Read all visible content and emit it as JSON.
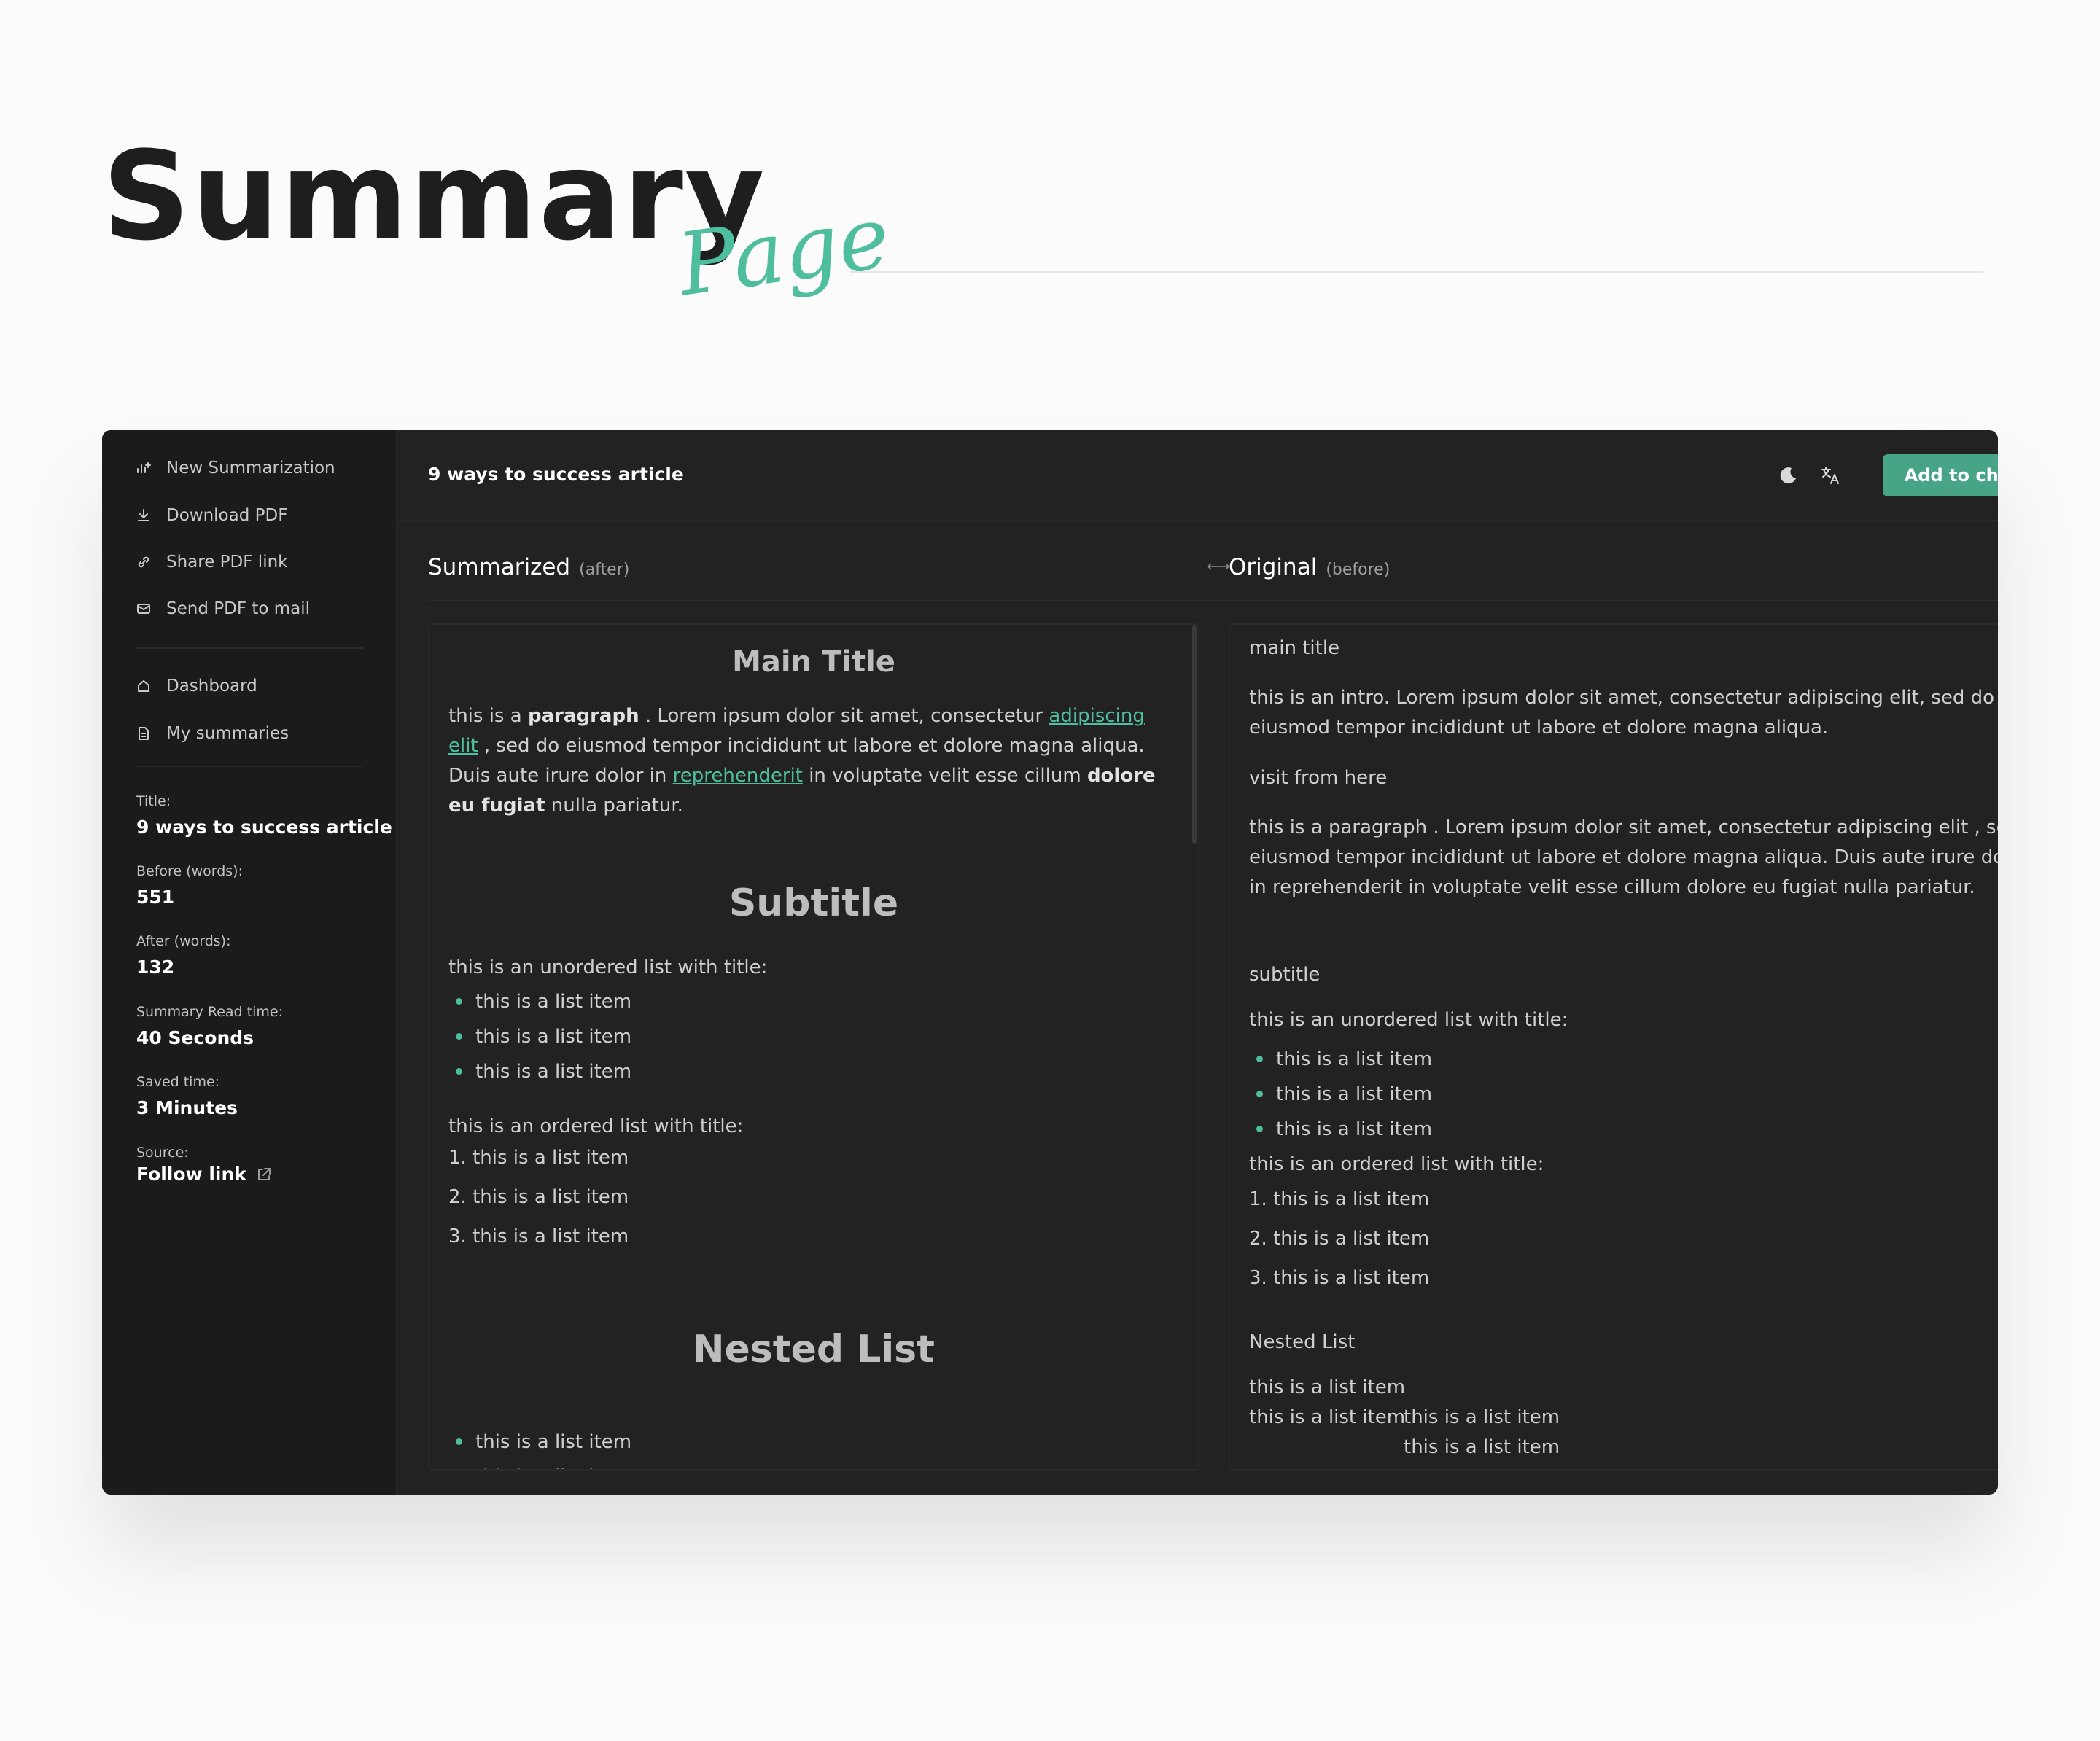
{
  "hero": {
    "title": "Summary",
    "script": "Page"
  },
  "sidebar": {
    "actions": [
      {
        "label": "New Summarization",
        "icon": "new-summary-icon"
      },
      {
        "label": "Download PDF",
        "icon": "download-icon"
      },
      {
        "label": "Share PDF link",
        "icon": "link-icon"
      },
      {
        "label": "Send PDF to mail",
        "icon": "mail-icon"
      }
    ],
    "nav": [
      {
        "label": "Dashboard",
        "icon": "home-icon"
      },
      {
        "label": "My summaries",
        "icon": "document-icon"
      }
    ],
    "meta": {
      "title_label": "Title:",
      "title_value": "9 ways to success article",
      "before_label": "Before (words):",
      "before_value": "551",
      "after_label": "After (words):",
      "after_value": "132",
      "read_label": "Summary Read time:",
      "read_value": "40 Seconds",
      "saved_label": "Saved time:",
      "saved_value": "3 Minutes",
      "source_label": "Source:",
      "source_link": "Follow link"
    }
  },
  "header": {
    "title": "9 ways to success article",
    "cta": "Add to chrome",
    "icons": [
      "moon-icon",
      "translate-icon"
    ]
  },
  "summarized": {
    "title": "Summarized",
    "subtitle": "(after)",
    "main_title": "Main Title",
    "para_1": "this is a",
    "para_bold_1": "paragraph",
    "para_2": ". Lorem ipsum dolor sit amet, consectetur",
    "para_link_1": "adipiscing elit",
    "para_3": ", sed do eiusmod tempor incididunt ut labore et dolore magna aliqua. Duis aute irure dolor in",
    "para_link_2": "reprehenderit",
    "para_4": "in voluptate velit esse cillum",
    "para_bold_2": "dolore eu fugiat",
    "para_5": "nulla pariatur.",
    "subtitle_heading": "Subtitle",
    "ul_title": "this is an unordered list with title:",
    "ul_items": [
      "this is a list item",
      "this is a list item",
      "this is a list item"
    ],
    "ol_title": "this is an ordered list with title:",
    "ol_items": [
      "1. this is a list item",
      "2. this is a list item",
      "3. this is a list item"
    ],
    "nested_heading": "Nested List",
    "nested_items": [
      "this is a list item",
      "this is a list item"
    ]
  },
  "original": {
    "title": "Original",
    "subtitle": "(before)",
    "main_title": "main title",
    "intro": "this is an intro. Lorem ipsum dolor sit amet, consectetur adipiscing elit, sed do eiusmod tempor incididunt ut labore et dolore magna aliqua.",
    "visit": "visit from here",
    "paragraph": "this is a paragraph . Lorem ipsum dolor sit amet, consectetur adipiscing elit , sed do eiusmod tempor incididunt ut labore et dolore magna aliqua. Duis aute irure dolor in reprehenderit in voluptate velit esse cillum dolore eu fugiat nulla pariatur.",
    "subtitle_text": "subtitle",
    "ul_title": "this is an unordered list with title:",
    "ul_items": [
      "this is a list item",
      "this is a list item",
      "this is a list item"
    ],
    "ol_title": "this is an ordered list with title:",
    "ol_items": [
      "1. this is a list item",
      "2. this is a list item",
      "3. this is a list item"
    ],
    "nested_heading": "Nested List",
    "nested_rows": [
      "this is a list item",
      "this is a list item",
      "this is a list item",
      "this is a list item"
    ]
  },
  "colors": {
    "accent": "#4fbe9e",
    "button": "#48a486",
    "panel": "#222222",
    "sidebar": "#1b1b1b"
  }
}
